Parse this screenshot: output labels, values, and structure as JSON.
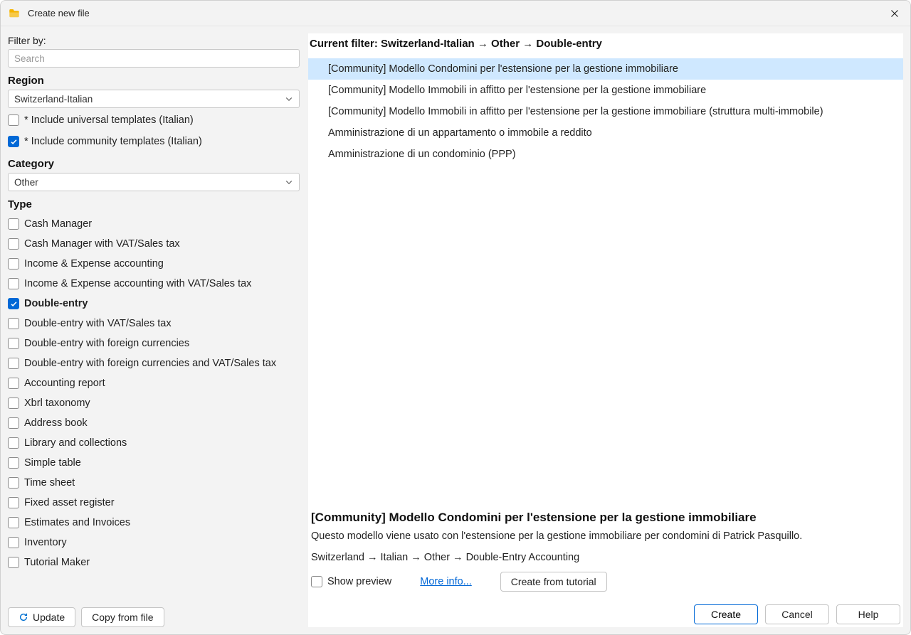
{
  "window": {
    "title": "Create new file"
  },
  "sidebar": {
    "filter_by_label": "Filter by:",
    "search_placeholder": "Search",
    "region_label": "Region",
    "region_value": "Switzerland-Italian",
    "include_universal": {
      "label": "* Include universal templates (Italian)",
      "checked": false
    },
    "include_community": {
      "label": "* Include community templates (Italian)",
      "checked": true
    },
    "category_label": "Category",
    "category_value": "Other",
    "type_label": "Type",
    "types": [
      {
        "label": "Cash Manager",
        "checked": false
      },
      {
        "label": "Cash Manager with VAT/Sales tax",
        "checked": false
      },
      {
        "label": "Income & Expense accounting",
        "checked": false
      },
      {
        "label": "Income & Expense accounting with VAT/Sales tax",
        "checked": false
      },
      {
        "label": "Double-entry",
        "checked": true
      },
      {
        "label": "Double-entry with VAT/Sales tax",
        "checked": false
      },
      {
        "label": "Double-entry with foreign currencies",
        "checked": false
      },
      {
        "label": "Double-entry with foreign currencies and VAT/Sales tax",
        "checked": false
      },
      {
        "label": "Accounting report",
        "checked": false
      },
      {
        "label": "Xbrl taxonomy",
        "checked": false
      },
      {
        "label": "Address book",
        "checked": false
      },
      {
        "label": "Library and collections",
        "checked": false
      },
      {
        "label": "Simple table",
        "checked": false
      },
      {
        "label": "Time sheet",
        "checked": false
      },
      {
        "label": "Fixed asset register",
        "checked": false
      },
      {
        "label": "Estimates and Invoices",
        "checked": false
      },
      {
        "label": "Inventory",
        "checked": false
      },
      {
        "label": "Tutorial Maker",
        "checked": false
      }
    ],
    "update_label": "Update",
    "copy_from_file_label": "Copy from file"
  },
  "main": {
    "current_filter_prefix": "Current filter: ",
    "current_filter_value": "Switzerland-Italian → Other → Double-entry",
    "templates": [
      {
        "label": "[Community] Modello Condomini per l'estensione per la gestione immobiliare",
        "selected": true
      },
      {
        "label": "[Community] Modello Immobili in affitto per l'estensione per la gestione immobiliare",
        "selected": false
      },
      {
        "label": "[Community] Modello Immobili in affitto per l'estensione per la gestione immobiliare (struttura multi-immobile)",
        "selected": false
      },
      {
        "label": "Amministrazione di un appartamento o immobile a reddito",
        "selected": false
      },
      {
        "label": "Amministrazione di un condominio (PPP)",
        "selected": false
      }
    ],
    "detail": {
      "title": "[Community] Modello Condomini per l'estensione per la gestione immobiliare",
      "description": "Questo modello viene usato con l'estensione per la gestione immobiliare per condomini di Patrick Pasquillo.",
      "breadcrumb": "Switzerland → Italian → Other → Double-Entry Accounting",
      "show_preview": {
        "label": "Show preview",
        "checked": false
      },
      "more_info_label": "More info...",
      "create_from_tutorial_label": "Create from tutorial"
    }
  },
  "footer": {
    "create_label": "Create",
    "cancel_label": "Cancel",
    "help_label": "Help"
  }
}
